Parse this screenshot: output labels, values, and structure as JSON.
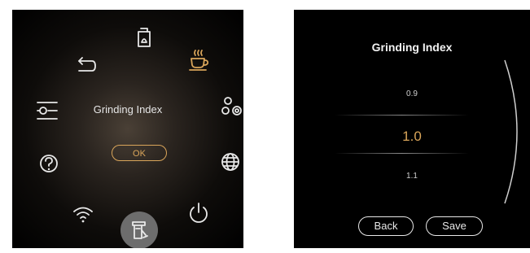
{
  "left_screen": {
    "title": "Grinding Index",
    "ok_label": "OK",
    "menu_icons": [
      "refill-icon",
      "coffee-cup-icon",
      "settings-nodes-icon",
      "globe-icon",
      "power-icon",
      "clean-icon",
      "wifi-icon",
      "help-icon",
      "menu-settings-icon",
      "back-arrow-icon"
    ]
  },
  "right_screen": {
    "title": "Grinding Index",
    "prev_value": "0.9",
    "current_value": "1.0",
    "next_value": "1.1",
    "back_label": "Back",
    "save_label": "Save"
  },
  "colors": {
    "accent": "#d9a55a",
    "background": "#000000",
    "text": "#e6e6e6"
  }
}
